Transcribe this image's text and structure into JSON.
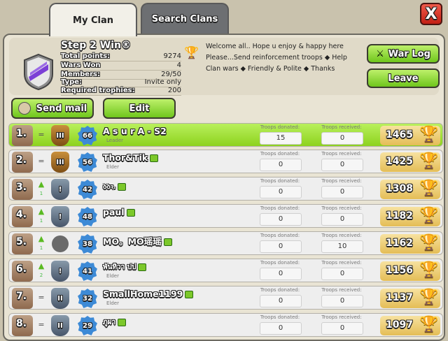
{
  "tabs": {
    "my_clan": "My Clan",
    "search_clans": "Search Clans"
  },
  "close_label": "X",
  "clan": {
    "name": "Step 2 Win®",
    "stats": [
      {
        "label": "Total points:",
        "value": "9274"
      },
      {
        "label": "Wars Won",
        "value": "4"
      },
      {
        "label": "Members:",
        "value": "29/50"
      },
      {
        "label": "Type:",
        "value": "Invite only"
      },
      {
        "label": "Required trophies:",
        "value": "200"
      }
    ],
    "description": [
      "Welcome all.. Hope u enjoy & happy here",
      "Please...Send reinforcement troops  ◆  Help",
      "Clan wars  ◆  Friendly & Polite  ◆  Thanks"
    ]
  },
  "buttons": {
    "war_log": "War Log",
    "leave": "Leave",
    "send_mail": "Send mail",
    "edit": "Edit"
  },
  "labels": {
    "troops_donated": "Troops donated:",
    "troops_received": "Troops received:"
  },
  "members": [
    {
      "rank": "1.",
      "move": "=",
      "move_n": "",
      "league": "III",
      "level": "66",
      "name": "A s u r A - S2",
      "role": "Leader",
      "donated": "15",
      "received": "0",
      "trophies": "1465"
    },
    {
      "rank": "2.",
      "move": "=",
      "move_n": "",
      "league": "III",
      "level": "56",
      "name": "Thor&Tik",
      "role": "Elder",
      "donated": "0",
      "received": "0",
      "trophies": "1425"
    },
    {
      "rank": "3.",
      "move": "▲",
      "move_n": "1",
      "league": "!",
      "level": "42",
      "name": "ꝺꝺꝛ.",
      "role": "",
      "donated": "0",
      "received": "0",
      "trophies": "1308"
    },
    {
      "rank": "4.",
      "move": "▲",
      "move_n": "1",
      "league": "!",
      "level": "48",
      "name": "paul",
      "role": "",
      "donated": "0",
      "received": "0",
      "trophies": "1182"
    },
    {
      "rank": "5.",
      "move": "▲",
      "move_n": "1",
      "league": "",
      "level": "38",
      "name": "MO。MO瑶瑶",
      "role": "",
      "donated": "0",
      "received": "10",
      "trophies": "1162"
    },
    {
      "rank": "6.",
      "move": "▲",
      "move_n": "2",
      "league": "!",
      "level": "41",
      "name": "พันทิวา ปป",
      "role": "Elder",
      "donated": "0",
      "received": "0",
      "trophies": "1156"
    },
    {
      "rank": "7.",
      "move": "=",
      "move_n": "",
      "league": "II",
      "level": "32",
      "name": "SmallHome1199",
      "role": "Elder",
      "donated": "0",
      "received": "0",
      "trophies": "1137"
    },
    {
      "rank": "8.",
      "move": "=",
      "move_n": "",
      "league": "II",
      "level": "29",
      "name": "ภูผา",
      "role": "",
      "donated": "0",
      "received": "0",
      "trophies": "1097"
    }
  ]
}
